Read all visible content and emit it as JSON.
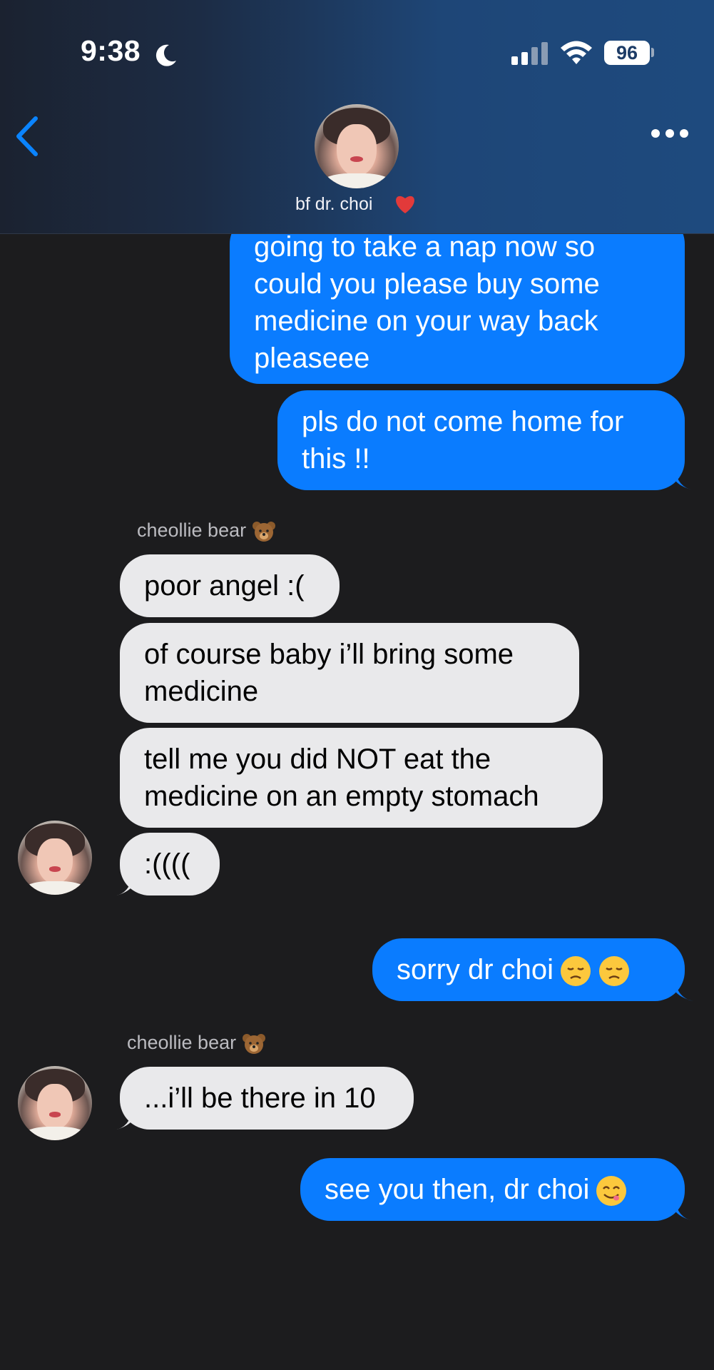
{
  "status_bar": {
    "time": "9:38",
    "battery": "96"
  },
  "header": {
    "contact_name": "bf dr. choi"
  },
  "messages": [
    {
      "type": "outgoing",
      "lines": [
        "going to take a nap now so",
        "could you please buy some",
        "medicine on your way back",
        "pleaseee"
      ]
    },
    {
      "type": "outgoing",
      "lines": [
        "pls do not come home for",
        "this !!"
      ]
    },
    {
      "type": "sender",
      "name": "cheollie bear"
    },
    {
      "type": "incoming",
      "lines": [
        "poor angel :("
      ]
    },
    {
      "type": "incoming",
      "lines": [
        "of course baby i’ll bring some",
        "medicine"
      ]
    },
    {
      "type": "incoming",
      "lines": [
        "tell me you did NOT eat the",
        "medicine on an empty stomach"
      ]
    },
    {
      "type": "incoming",
      "lines": [
        ":(((("
      ]
    },
    {
      "type": "outgoing",
      "lines": [
        "sorry dr choi"
      ]
    },
    {
      "type": "sender",
      "name": "cheollie bear"
    },
    {
      "type": "incoming",
      "lines": [
        "...i’ll be there in 10"
      ]
    },
    {
      "type": "outgoing",
      "lines": [
        "see you then, dr choi"
      ]
    }
  ],
  "icons": [
    "moon-icon",
    "signal-icon",
    "wifi-icon",
    "back-chevron-icon",
    "more-icon",
    "heart-emoji",
    "bear-emoji",
    "disappointed-emoji",
    "yum-emoji"
  ],
  "colors": {
    "outgoing": "#0a7cff",
    "incoming": "#e9e9eb",
    "background": "#1c1c1e",
    "accent": "#0a84ff"
  }
}
